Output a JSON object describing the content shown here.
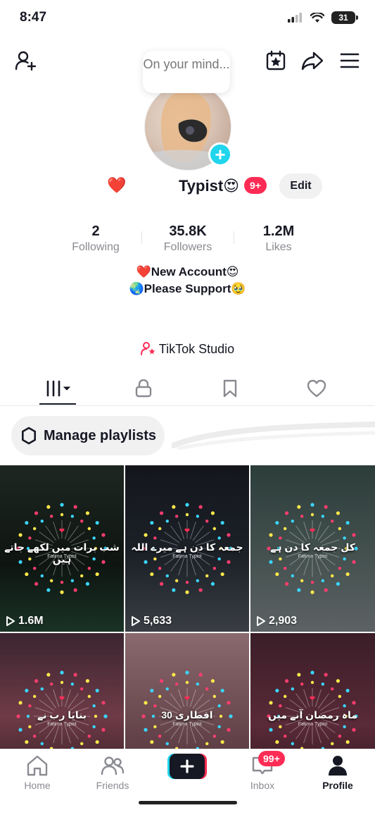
{
  "status_bar": {
    "time": "8:47",
    "battery": "31"
  },
  "profile": {
    "thought_bubble": "On your mind...",
    "name_prefix": "❤️",
    "username": "Typist😍",
    "badge": "9+",
    "edit_label": "Edit"
  },
  "stats": [
    {
      "value": "2",
      "label": "Following"
    },
    {
      "value": "35.8K",
      "label": "Followers"
    },
    {
      "value": "1.2M",
      "label": "Likes"
    }
  ],
  "bio": {
    "line1": "❤️New Account😍",
    "line2": "🌏Please Support🥹"
  },
  "studio_label": "TikTok Studio",
  "manage_playlists": "Manage playlists",
  "videos": [
    {
      "count": "1.6M",
      "caption": "شب برات میں لکھے جاتے ہیں",
      "sub": "Fatima Typist"
    },
    {
      "count": "5,633",
      "caption": "جمعہ کا دن ہے میرے اللہ",
      "sub": "Fatima Typist"
    },
    {
      "count": "2,903",
      "caption": "کل جمعہ کا دن ہے",
      "sub": "Fatima Typist"
    },
    {
      "count": "",
      "caption": "بنایا رب نے",
      "sub": "Fatima Typist"
    },
    {
      "count": "",
      "caption": "30 افطاری",
      "sub": "Fatima Typist"
    },
    {
      "count": "",
      "caption": "ماہ رمضان آنے میں",
      "sub": "Fatima Typist"
    }
  ],
  "nav": {
    "home": "Home",
    "friends": "Friends",
    "inbox": "Inbox",
    "inbox_badge": "99+",
    "profile": "Profile"
  },
  "colors": {
    "accent": "#fe2c55",
    "cyan": "#20d5ec"
  }
}
